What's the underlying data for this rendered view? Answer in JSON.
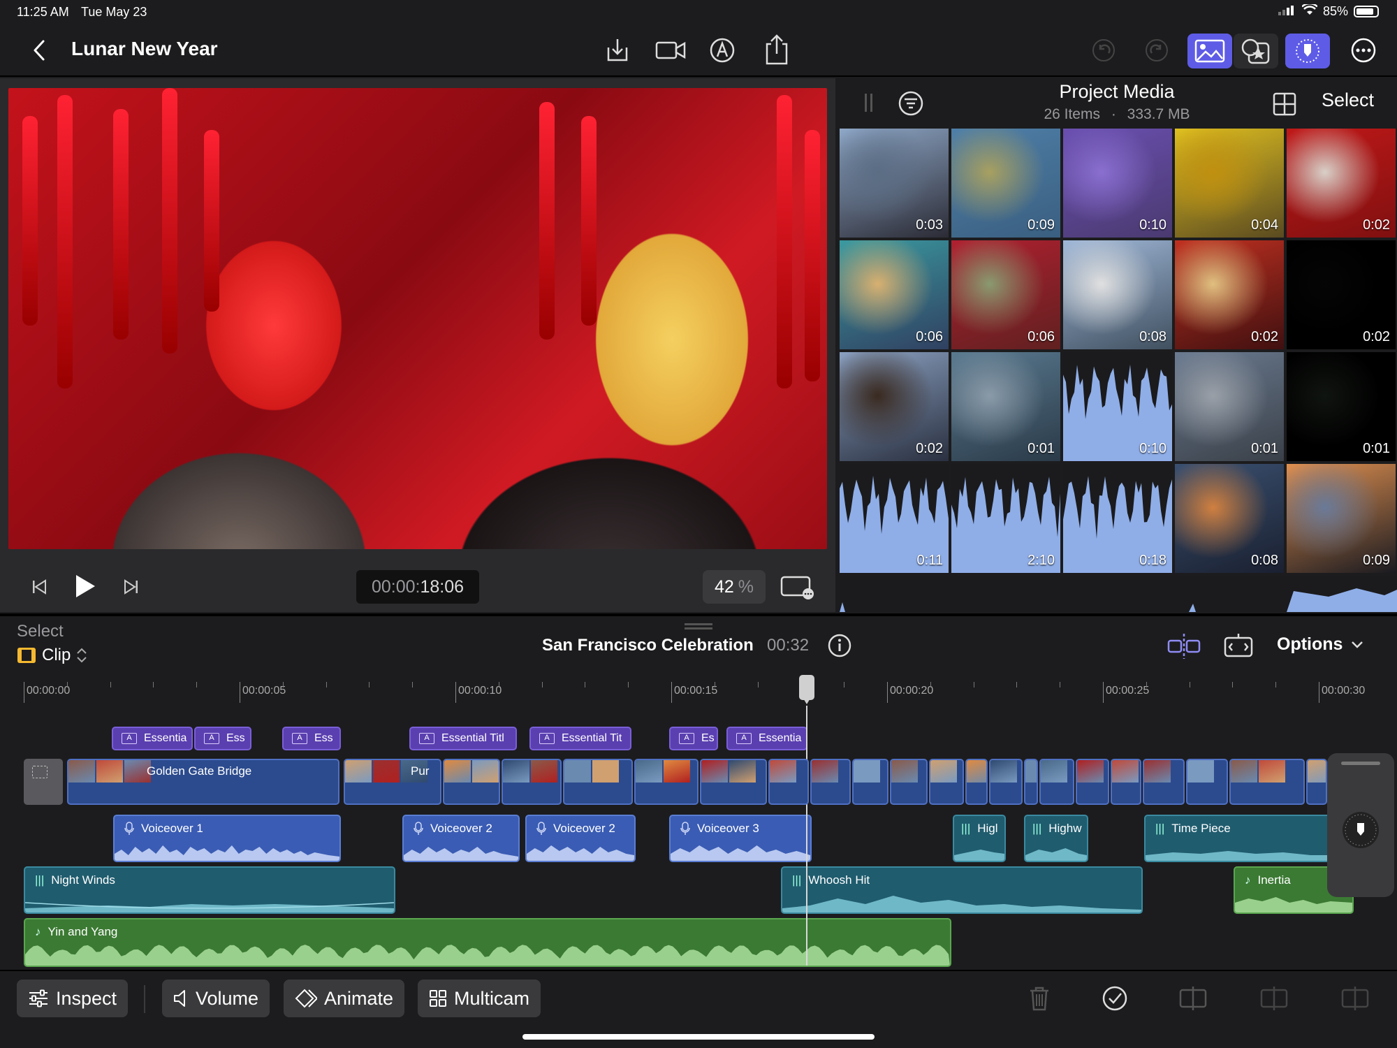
{
  "status": {
    "time": "11:25 AM",
    "date": "Tue May 23",
    "battery": "85%",
    "battery_level": 0.85
  },
  "header": {
    "title": "Lunar New Year"
  },
  "viewer": {
    "timecode_prefix": "00:00:",
    "timecode_main": "18:06",
    "zoom_value": "42",
    "zoom_unit": "%"
  },
  "browser": {
    "title": "Project Media",
    "item_count": "26 Items",
    "separator": "·",
    "size": "333.7 MB",
    "select_label": "Select",
    "thumbnails": [
      {
        "duration": "0:03",
        "kind": "video",
        "colors": [
          "#8fa8c8",
          "#5b6d84",
          "#2b2b35"
        ]
      },
      {
        "duration": "0:09",
        "kind": "video",
        "colors": [
          "#4f7fa8",
          "#a8a060",
          "#3a5f80"
        ]
      },
      {
        "duration": "0:10",
        "kind": "video",
        "colors": [
          "#6a4fb0",
          "#8a6fd0",
          "#4a3a70"
        ]
      },
      {
        "duration": "0:04",
        "kind": "video",
        "colors": [
          "#e0c020",
          "#c09010",
          "#5a4a20"
        ]
      },
      {
        "duration": "0:02",
        "kind": "video",
        "colors": [
          "#c01818",
          "#d8d0c8",
          "#801010"
        ]
      },
      {
        "duration": "0:06",
        "kind": "video",
        "colors": [
          "#3a9aa0",
          "#d8b070",
          "#304060"
        ]
      },
      {
        "duration": "0:06",
        "kind": "video",
        "colors": [
          "#b02030",
          "#8a9a70",
          "#602020"
        ]
      },
      {
        "duration": "0:08",
        "kind": "video",
        "colors": [
          "#a0b8d8",
          "#e0e0e0",
          "#405060"
        ]
      },
      {
        "duration": "0:02",
        "kind": "video",
        "colors": [
          "#c03020",
          "#e0c080",
          "#401010"
        ]
      },
      {
        "duration": "0:02",
        "kind": "video",
        "colors": [
          "#000000",
          "#050505",
          "#000000"
        ]
      },
      {
        "duration": "0:02",
        "kind": "video",
        "colors": [
          "#8aa0c0",
          "#3a2a20",
          "#2a3040"
        ]
      },
      {
        "duration": "0:01",
        "kind": "video",
        "colors": [
          "#5a7a90",
          "#8a9aa8",
          "#2a3a48"
        ]
      },
      {
        "duration": "0:10",
        "kind": "audio",
        "colors": [
          "#8faee8"
        ]
      },
      {
        "duration": "0:01",
        "kind": "video",
        "colors": [
          "#6a7a90",
          "#9aa0a8",
          "#3a4048"
        ]
      },
      {
        "duration": "0:01",
        "kind": "video",
        "colors": [
          "#000000",
          "#101410",
          "#000000"
        ]
      },
      {
        "duration": "0:11",
        "kind": "audio",
        "colors": [
          "#8faee8"
        ]
      },
      {
        "duration": "2:10",
        "kind": "audio",
        "colors": [
          "#8faee8"
        ]
      },
      {
        "duration": "0:18",
        "kind": "audio",
        "colors": [
          "#8faee8"
        ]
      },
      {
        "duration": "0:08",
        "kind": "video",
        "colors": [
          "#3a5070",
          "#d08040",
          "#1a2030"
        ]
      },
      {
        "duration": "0:09",
        "kind": "video",
        "colors": [
          "#e09050",
          "#6a7a98",
          "#1a1a20"
        ]
      }
    ]
  },
  "timeline_header": {
    "select_label": "Select",
    "mode_label": "Clip",
    "project_name": "San Francisco Celebration",
    "project_duration": "00:32",
    "options_label": "Options"
  },
  "ruler": {
    "labels": [
      "00:00:00",
      "00:00:05",
      "00:00:10",
      "00:00:15",
      "00:00:20",
      "00:00:25",
      "00:00:30"
    ]
  },
  "timeline": {
    "titles": [
      "Essentia",
      "Ess",
      "Ess",
      "Essential Titl",
      "Essential Tit",
      "Es",
      "Essentia"
    ],
    "video": {
      "first_label": "Golden Gate Bridge",
      "second_label": "Pur"
    },
    "voiceovers": [
      "Voiceover 1",
      "Voiceover 2",
      "Voiceover 2",
      "Voiceover 3"
    ],
    "sfx": [
      "Higl",
      "Highw",
      "Time Piece",
      "Night Winds",
      "Whoosh Hit",
      "Inertia"
    ],
    "music": [
      "Yin and Yang"
    ]
  },
  "toolbar": {
    "inspect": "Inspect",
    "volume": "Volume",
    "animate": "Animate",
    "multicam": "Multicam"
  },
  "colors": {
    "accent": "#5e5ce6",
    "title_clip": "#5a3fb0",
    "video_clip": "#2c4b8e",
    "audio_teal": "#1f5c6e",
    "music_green": "#3b7a33"
  }
}
